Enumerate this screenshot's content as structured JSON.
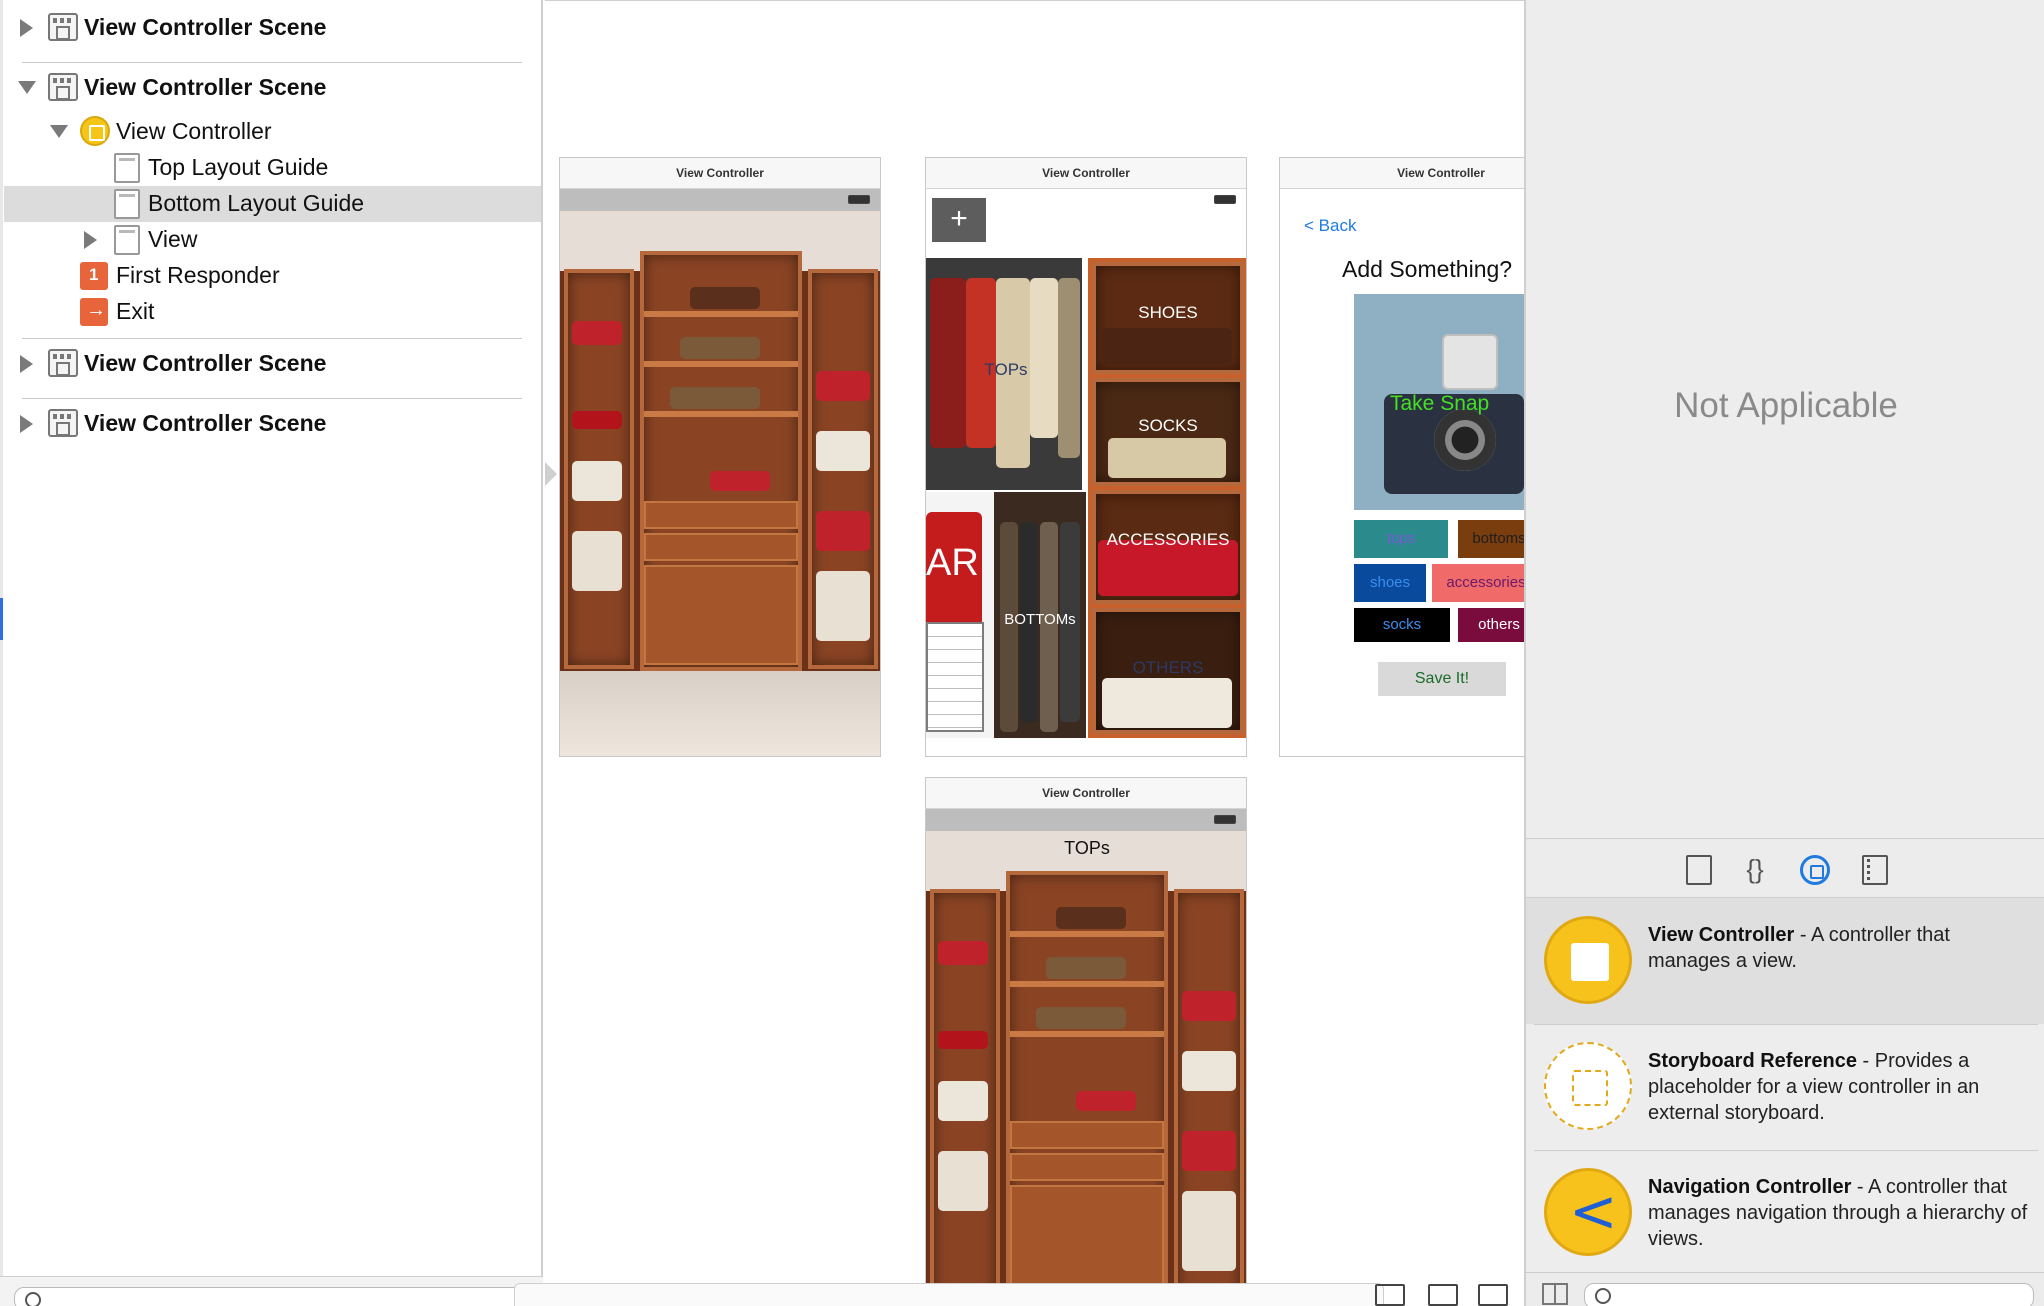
{
  "outline": {
    "scene1": "View Controller Scene",
    "scene2": "View Controller Scene",
    "vc": "View Controller",
    "top_guide": "Top Layout Guide",
    "bottom_guide": "Bottom Layout Guide",
    "view": "View",
    "first_responder": "First Responder",
    "exit": "Exit",
    "scene3": "View Controller Scene",
    "scene4": "View Controller Scene"
  },
  "canvas": {
    "phone1_title": "View Controller",
    "phone2_title": "View Controller",
    "phone3_title": "View Controller",
    "phone4_title": "View Controller",
    "plus": "+",
    "tops_btn": "TOPs",
    "shoes_btn": "SHOES",
    "socks_btn": "SOCKS",
    "accessories_btn": "ACCESSORIES",
    "bottoms_btn": "BOTTOMs",
    "others_btn": "OTHERS",
    "calendar_text": "AR",
    "back": "< Back",
    "add_title": "Add Something?",
    "take_snap": "Take Snap",
    "tags": {
      "tops": "tops",
      "bottoms": "bottoms",
      "shoes": "shoes",
      "accessories": "accessories",
      "socks": "socks",
      "others": "others"
    },
    "save": "Save It!",
    "tops_title": "TOPs"
  },
  "inspector": {
    "not_applicable": "Not Applicable",
    "library": [
      {
        "name": "View Controller",
        "desc": " - A controller that manages a view."
      },
      {
        "name": "Storyboard Reference",
        "desc": " - Provides a placeholder for a view controller in an external storyboard."
      },
      {
        "name": "Navigation Controller",
        "desc": " - A controller that manages navigation through a hierarchy of views."
      }
    ]
  },
  "colors": {
    "link_blue": "#1e7be2",
    "accent_blue": "#1f7ae0",
    "library_yellow": "#f7c21c",
    "take_snap_green": "#45e022",
    "tag_tops_bg": "#2a8a8c",
    "tag_bottoms_bg": "#7a3d0e",
    "tag_shoes_bg": "#0a4a9c",
    "tag_accessories_bg": "#f06a6a",
    "tag_socks_bg": "#000000",
    "tag_others_bg": "#7a0b3d"
  }
}
